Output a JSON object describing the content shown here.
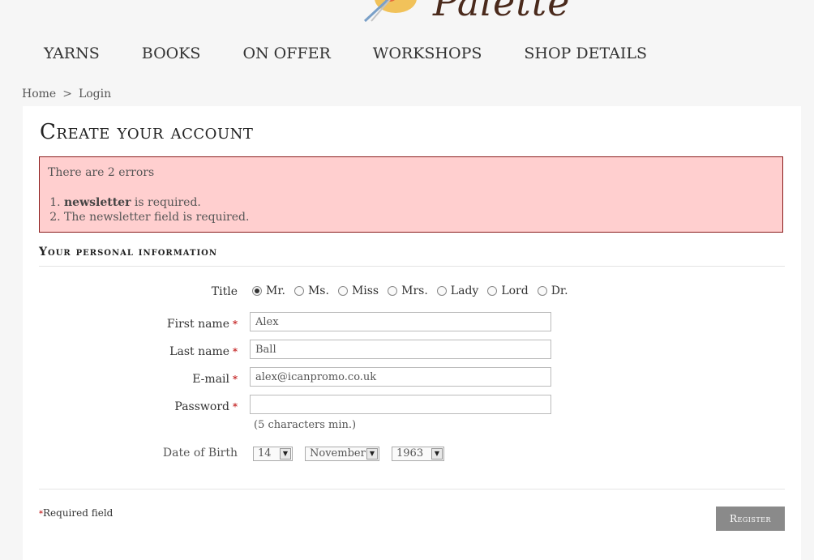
{
  "brand": {
    "logo_text": "Palette"
  },
  "nav": [
    "YARNS",
    "BOOKS",
    "ON OFFER",
    "WORKSHOPS",
    "SHOP DETAILS"
  ],
  "breadcrumb": {
    "home": "Home",
    "separator": ">",
    "current": "Login"
  },
  "page_title": "Create your account",
  "errors": {
    "lead": "There are 2 errors",
    "items": [
      {
        "strong": "newsletter",
        "text": " is required."
      },
      {
        "strong": "",
        "text": "The newsletter field is required."
      }
    ]
  },
  "section_title": "Your personal information",
  "form": {
    "title_label": "Title",
    "title_options": [
      "Mr.",
      "Ms.",
      "Miss",
      "Mrs.",
      "Lady",
      "Lord",
      "Dr."
    ],
    "title_selected": "Mr.",
    "first_name_label": "First name",
    "first_name_value": "Alex",
    "last_name_label": "Last name",
    "last_name_value": "Ball",
    "email_label": "E-mail",
    "email_value": "alex@icanpromo.co.uk",
    "password_label": "Password",
    "password_value": "",
    "password_hint": "(5 characters min.)",
    "dob_label": "Date of Birth",
    "dob_day": "14",
    "dob_month": "November",
    "dob_year": "1963",
    "required_marker": "*"
  },
  "footer": {
    "required_note": "Required field",
    "register_label": "Register"
  },
  "colors": {
    "error_bg": "#ffcfcf",
    "error_border": "#8a1c1c",
    "button_bg": "#8a8a8a",
    "required_star": "#bb0000"
  }
}
